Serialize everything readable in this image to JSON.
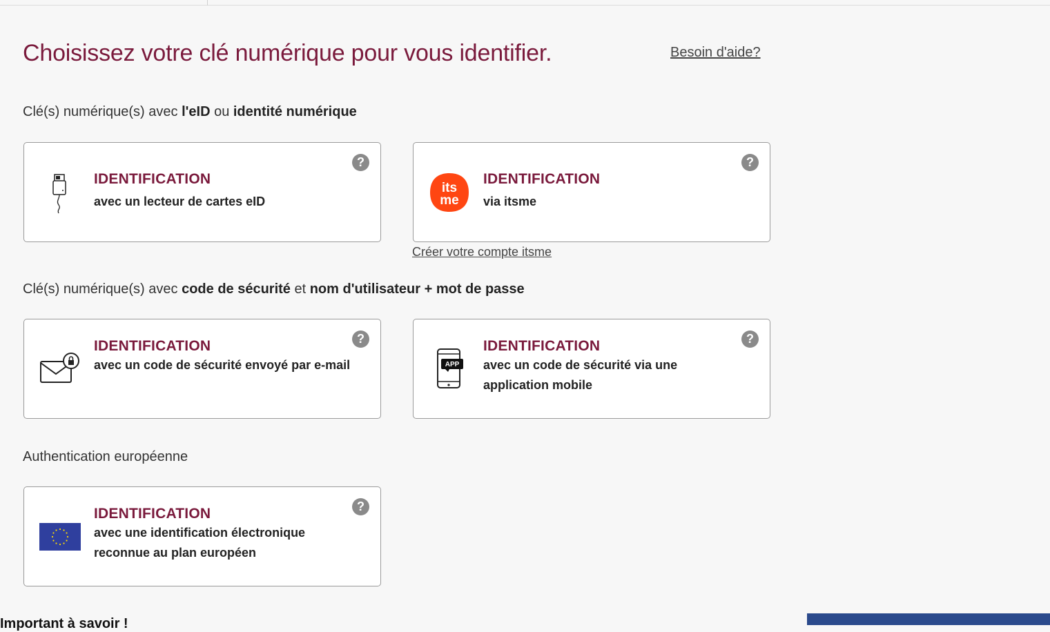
{
  "header": {
    "title": "Choisissez votre clé numérique pour vous identifier.",
    "help_link": "Besoin d'aide?"
  },
  "sections": [
    {
      "heading": {
        "prefix": "Clé(s) numérique(s) avec ",
        "bold1": "l'eID",
        "mid": " ou ",
        "bold2": "identité numérique"
      },
      "cards": [
        {
          "title": "IDENTIFICATION",
          "desc": "avec un lecteur de cartes eID",
          "icon": "card-reader-icon"
        },
        {
          "title": "IDENTIFICATION",
          "desc": "via itsme",
          "icon": "itsme-logo-icon",
          "sublink": "Créer votre compte itsme"
        }
      ]
    },
    {
      "heading": {
        "prefix": "Clé(s) numérique(s) avec ",
        "bold1": "code de sécurité",
        "mid": " et ",
        "bold2": "nom d'utilisateur + mot de passe"
      },
      "cards": [
        {
          "title": "IDENTIFICATION",
          "desc": "avec un code de sécurité envoyé par e-mail",
          "icon": "email-lock-icon"
        },
        {
          "title": "IDENTIFICATION",
          "desc": "avec un code de sécurité via une application mobile",
          "icon": "mobile-app-icon",
          "app_badge": "APP"
        }
      ]
    },
    {
      "heading": {
        "prefix": "Authentication européenne"
      },
      "cards": [
        {
          "title": "IDENTIFICATION",
          "desc": "avec une identification électronique reconnue au plan européen",
          "icon": "eu-flag-icon"
        }
      ]
    }
  ],
  "help_glyph": "?",
  "footer": {
    "note": "Important à savoir !"
  },
  "colors": {
    "brand": "#7a1a3c",
    "itsme": "#ff4612",
    "eu_blue": "#2f3f9e",
    "eu_star": "#ffdd00",
    "footer_button": "#2b4a8c"
  }
}
